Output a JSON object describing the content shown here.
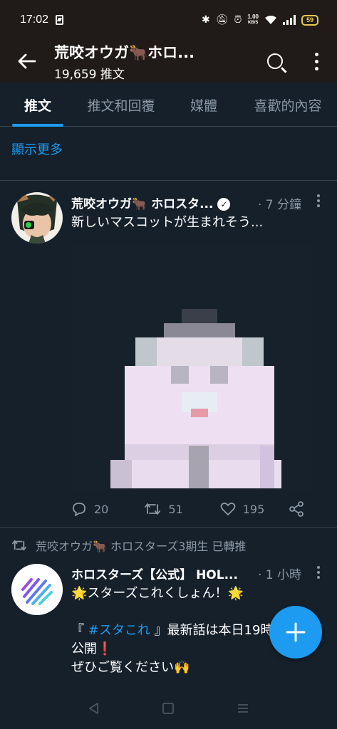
{
  "status_bar": {
    "time": "17:02",
    "speed_value": "1.00",
    "speed_unit": "KB/S",
    "battery": "59"
  },
  "header": {
    "title": "荒咬オウガ🐂ホロ...",
    "subtitle": "19,659 推文"
  },
  "tabs": [
    {
      "label": "推文",
      "active": true
    },
    {
      "label": "推文和回覆",
      "active": false
    },
    {
      "label": "媒體",
      "active": false
    },
    {
      "label": "喜歡的內容",
      "active": false
    }
  ],
  "show_more": "顯示更多",
  "tweet1": {
    "author": "荒咬オウガ🐂 ホロスタ...",
    "time": "· 7 分鐘",
    "text": "新しいマスコットが生まれそう...",
    "replies": "20",
    "retweets": "51",
    "likes": "195"
  },
  "retweet_banner": "荒咬オウガ🐂 ホロスターズ3期生 已轉推",
  "tweet2": {
    "author": "ホロスターズ【公式】 HOL...",
    "time": "· 1 小時",
    "line1": "🌟スターズこれくしょん！🌟",
    "line2_prefix": "『 ",
    "line2_hashtag": "#スタこれ",
    "line2_suffix": " 』最新話は本日19時から",
    "line3": "公開❗",
    "line4": "ぜひご覧ください🙌"
  },
  "colors": {
    "background": "#15202b",
    "accent": "#1d9bf0",
    "muted": "#8b98a5",
    "header_bg": "#201b18"
  }
}
